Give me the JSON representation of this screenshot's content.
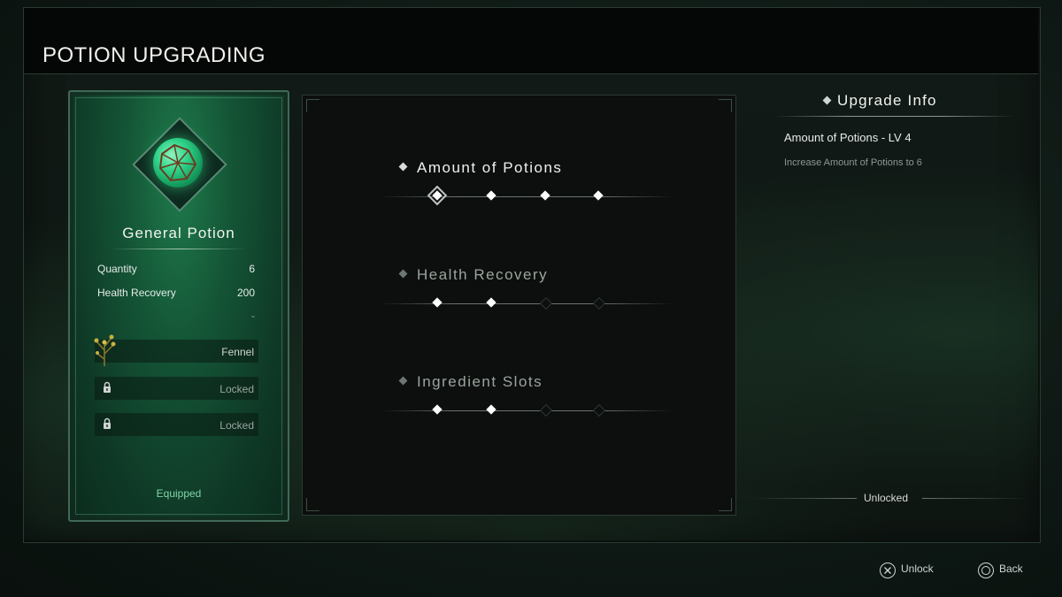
{
  "header": {
    "title": "POTION UPGRADING"
  },
  "card": {
    "name": "General Potion",
    "stats": [
      {
        "label": "Quantity",
        "value": "6"
      },
      {
        "label": "Health Recovery",
        "value": "200"
      },
      {
        "label": "",
        "value": "-"
      }
    ],
    "slots": [
      {
        "label": "Fennel",
        "icon": "fennel-herb-icon"
      },
      {
        "label": "Locked",
        "icon": "lock-icon"
      },
      {
        "label": "Locked",
        "icon": "lock-icon"
      }
    ],
    "status": "Equipped"
  },
  "upgrades": [
    {
      "name": "Amount of Potions",
      "levels": 4,
      "unlocked": 4,
      "selected": true
    },
    {
      "name": "Health Recovery",
      "levels": 4,
      "unlocked": 2,
      "selected": false
    },
    {
      "name": "Ingredient Slots",
      "levels": 4,
      "unlocked": 2,
      "selected": false
    }
  ],
  "info": {
    "title": "Upgrade Info",
    "heading": "Amount of Potions - LV 4",
    "description": "Increase Amount of Potions to 6",
    "status": "Unlocked"
  },
  "footer": {
    "unlock_label": "Unlock",
    "back_label": "Back"
  },
  "colors": {
    "accent": "#7fd6a6",
    "panel": "#0c0f0d"
  }
}
